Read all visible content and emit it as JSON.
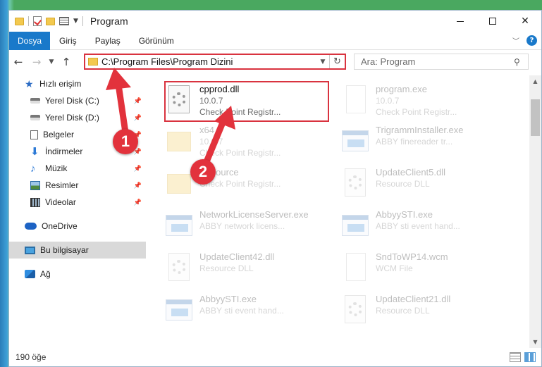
{
  "window": {
    "title": "Program"
  },
  "ribbon": {
    "tabs": [
      {
        "label": "Dosya",
        "active": true
      },
      {
        "label": "Giriş"
      },
      {
        "label": "Paylaş"
      },
      {
        "label": "Görünüm"
      }
    ],
    "help_label": "?"
  },
  "navigation": {
    "address": "C:\\Program Files\\Program Dizini",
    "search_placeholder": "Ara: Program"
  },
  "sidebar": {
    "quick_access": "Hızlı erişim",
    "items": [
      {
        "label": "Yerel Disk (C:)",
        "icon": "disk-icon",
        "pinned": true
      },
      {
        "label": "Yerel Disk (D:)",
        "icon": "disk-icon",
        "pinned": true
      },
      {
        "label": "Belgeler",
        "icon": "documents-icon",
        "pinned": true
      },
      {
        "label": "İndirmeler",
        "icon": "download-icon",
        "pinned": true
      },
      {
        "label": "Müzik",
        "icon": "music-icon",
        "pinned": true
      },
      {
        "label": "Resimler",
        "icon": "pictures-icon",
        "pinned": true
      },
      {
        "label": "Videolar",
        "icon": "videos-icon",
        "pinned": true
      }
    ],
    "onedrive": "OneDrive",
    "this_pc": "Bu bilgisayar",
    "network": "Ağ"
  },
  "files": [
    {
      "name": "cpprod.dll",
      "meta1": "10.0.7",
      "meta2": "Check Point Registr...",
      "icon": "dll-icon",
      "highlighted": true
    },
    {
      "name": "program.exe",
      "meta1": "10.0.7",
      "meta2": "Check Point Registr...",
      "icon": "exe-icon"
    },
    {
      "name": "x64",
      "meta1": "10.0.7",
      "meta2": "Check Point Registr...",
      "icon": "folder-icon"
    },
    {
      "name": "TrigrammInstaller.exe",
      "meta1": "ABBY finereader tr...",
      "meta2": "",
      "icon": "exe-icon"
    },
    {
      "name": "Resource",
      "meta1": "Check Point Registr...",
      "meta2": "",
      "icon": "folder-icon"
    },
    {
      "name": "UpdateClient5.dll",
      "meta1": "Resource DLL",
      "meta2": "",
      "icon": "dll-icon"
    },
    {
      "name": "NetworkLicenseServer.exe",
      "meta1": "ABBY network licens...",
      "meta2": "",
      "icon": "exe-icon"
    },
    {
      "name": "AbbyySTI.exe",
      "meta1": "ABBY sti event hand...",
      "meta2": "",
      "icon": "exe-icon"
    },
    {
      "name": "UpdateClient42.dll",
      "meta1": "Resource DLL",
      "meta2": "",
      "icon": "dll-icon"
    },
    {
      "name": "SndToWP14.wcm",
      "meta1": "WCM File",
      "meta2": "",
      "icon": "file-icon"
    },
    {
      "name": "AbbyySTI.exe",
      "meta1": "ABBY sti event hand...",
      "meta2": "",
      "icon": "exe-icon"
    },
    {
      "name": "UpdateClient21.dll",
      "meta1": "Resource DLL",
      "meta2": "",
      "icon": "dll-icon"
    }
  ],
  "status": {
    "item_count": "190 öğe"
  },
  "annotations": {
    "step1": "1",
    "step2": "2",
    "color": "#e2323c"
  }
}
